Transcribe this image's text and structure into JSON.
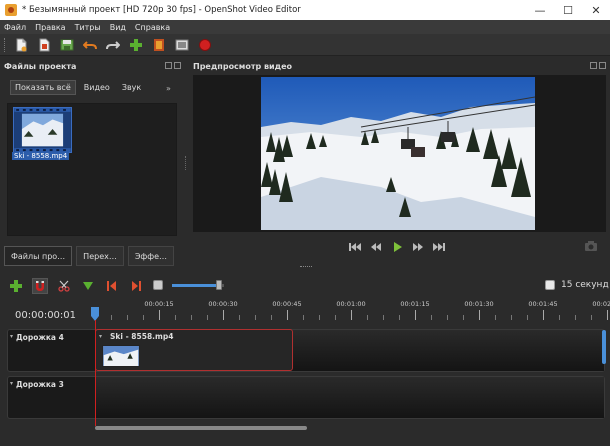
{
  "window": {
    "title": "* Безымянный проект [HD 720p 30 fps] - OpenShot Video Editor",
    "minimize": "—",
    "maximize": "☐",
    "close": "✕"
  },
  "menu": [
    "Файл",
    "Правка",
    "Титры",
    "Вид",
    "Справка"
  ],
  "toolbar": {
    "buttons": [
      "new-project-icon",
      "open-project-icon",
      "save-project-icon",
      "undo-icon",
      "redo-icon",
      "import-files-icon",
      "choose-profile-icon",
      "fullscreen-icon",
      "export-video-icon"
    ]
  },
  "files_panel": {
    "title": "Файлы проекта",
    "filter_tabs": [
      "Показать всё",
      "Видео",
      "Звук"
    ],
    "items": [
      {
        "name": "Ski - 8558.mp4"
      }
    ]
  },
  "bottom_tabs": [
    "Файлы про…",
    "Перех…",
    "Эффе…"
  ],
  "preview_panel": {
    "title": "Предпросмотр видео"
  },
  "timeline": {
    "timecode": "00:00:00:01",
    "zoom_label": "15 секунд",
    "zoom_level": 0.9,
    "ruler_labels": [
      "00:00:15",
      "00:00:30",
      "00:00:45",
      "00:01:00",
      "00:01:15",
      "00:01:30",
      "00:01:45",
      "00:02:00"
    ],
    "tracks": [
      {
        "name": "Дорожка 4",
        "clips": [
          {
            "name": "Ski - 8558.mp4"
          }
        ]
      },
      {
        "name": "Дорожка 3",
        "clips": []
      }
    ]
  },
  "colors": {
    "accent": "#4a90d9",
    "selected_clip_border": "#b03030",
    "playhead": "#d02020",
    "background": "#2b2b2b"
  }
}
